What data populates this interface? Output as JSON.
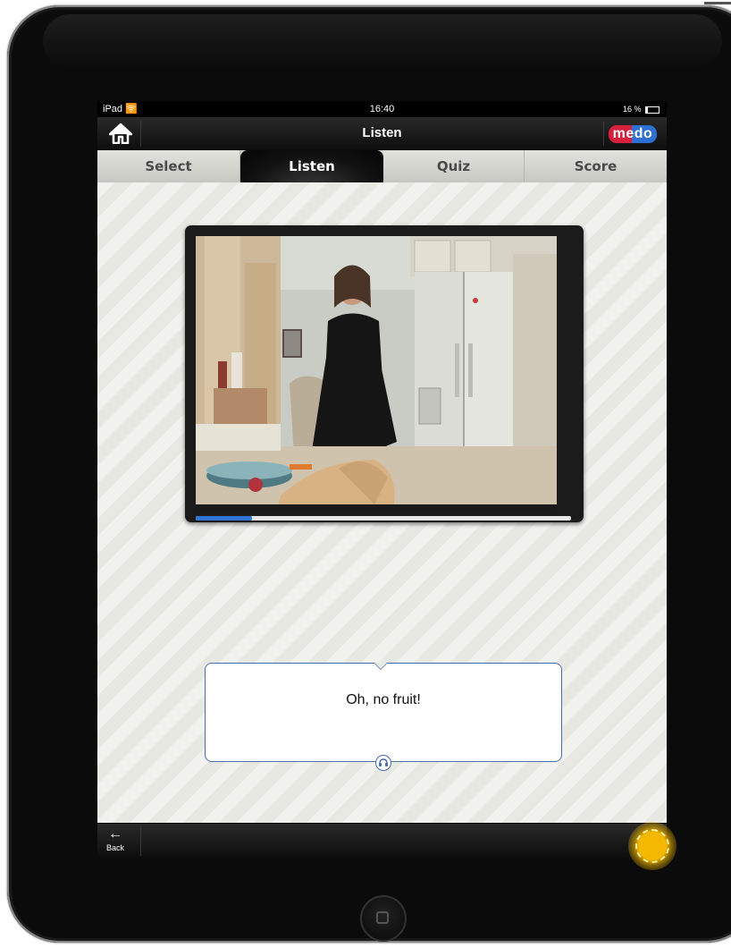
{
  "status_bar": {
    "device": "iPad",
    "time": "16:40",
    "battery": "16 %"
  },
  "header": {
    "title": "Listen",
    "home_icon": "home-icon",
    "logo": "medo"
  },
  "tabs": [
    {
      "label": "Select",
      "active": false
    },
    {
      "label": "Listen",
      "active": true
    },
    {
      "label": "Quiz",
      "active": false
    },
    {
      "label": "Score",
      "active": false
    }
  ],
  "video": {
    "progress": 0.15
  },
  "subtitle": {
    "text": "Oh, no fruit!",
    "icon": "headphones-icon"
  },
  "footer": {
    "back_label": "Back",
    "back_icon": "arrow-left-icon"
  },
  "colors": {
    "accent": "#2f74d6",
    "bubble_border": "#4a6cad",
    "touch": "#f5b800"
  }
}
